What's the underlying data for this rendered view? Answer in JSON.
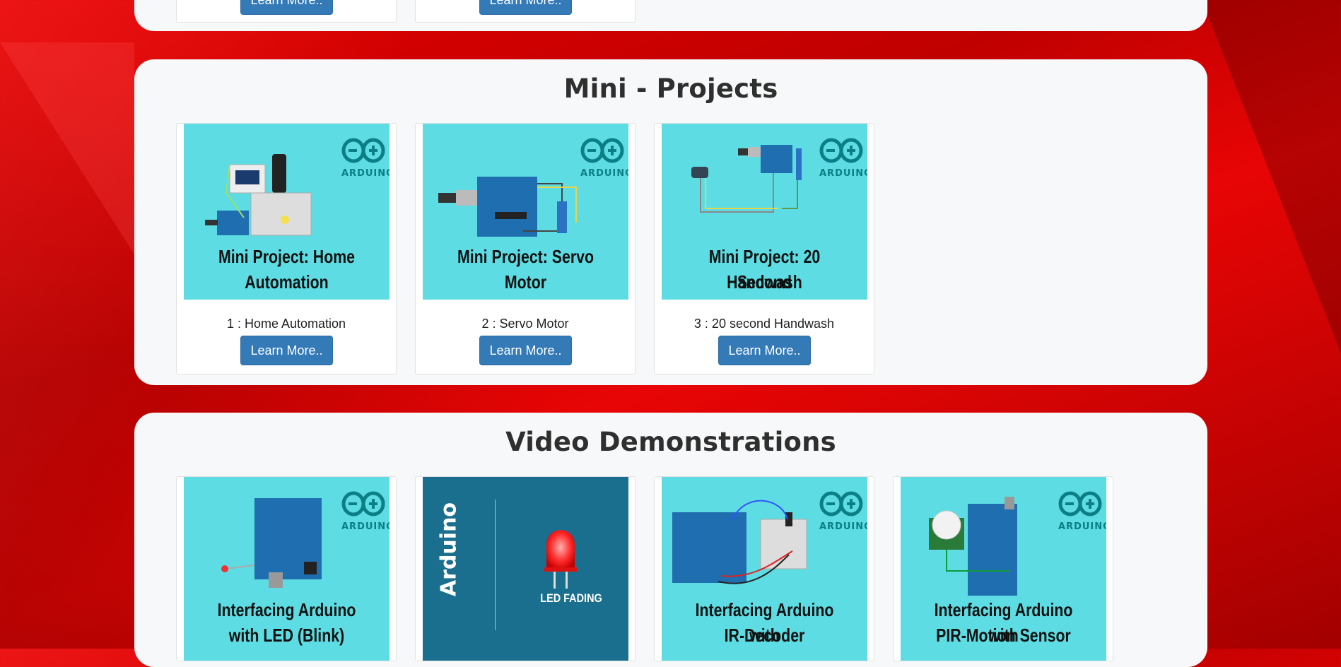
{
  "top_panel": {
    "buttons": [
      "Learn More..",
      "Learn More.."
    ]
  },
  "mini_projects": {
    "heading": "Mini - Projects",
    "cards": [
      {
        "caption_line1": "Mini Project: Home",
        "caption_line2": "Automation",
        "title": "1 : Home Automation",
        "button": "Learn More.."
      },
      {
        "caption_line1": "Mini Project: Servo",
        "caption_line2": "Motor",
        "title": "2 : Servo Motor",
        "button": "Learn More.."
      },
      {
        "caption_line1": "Mini Project: 20 Second",
        "caption_line2": "Handwash",
        "title": "3 : 20 second Handwash",
        "button": "Learn More.."
      }
    ]
  },
  "video_demos": {
    "heading": "Video Demonstrations",
    "cards": [
      {
        "caption_line1": "Interfacing Arduino",
        "caption_line2": "with LED (Blink)"
      },
      {
        "vertical_brand": "Arduino",
        "caption_line1": "LED FADING"
      },
      {
        "caption_line1": "Interfacing Arduino with",
        "caption_line2": "IR-Decoder"
      },
      {
        "caption_line1": "Interfacing Arduino with",
        "caption_line2": "PIR-Motion Sensor"
      }
    ]
  },
  "logo_text": "ARDUINO",
  "colors": {
    "background_red": "#d40000",
    "panel": "#f7f8f9",
    "thumb_teal": "#5ddde3",
    "button_blue": "#337ab7"
  }
}
